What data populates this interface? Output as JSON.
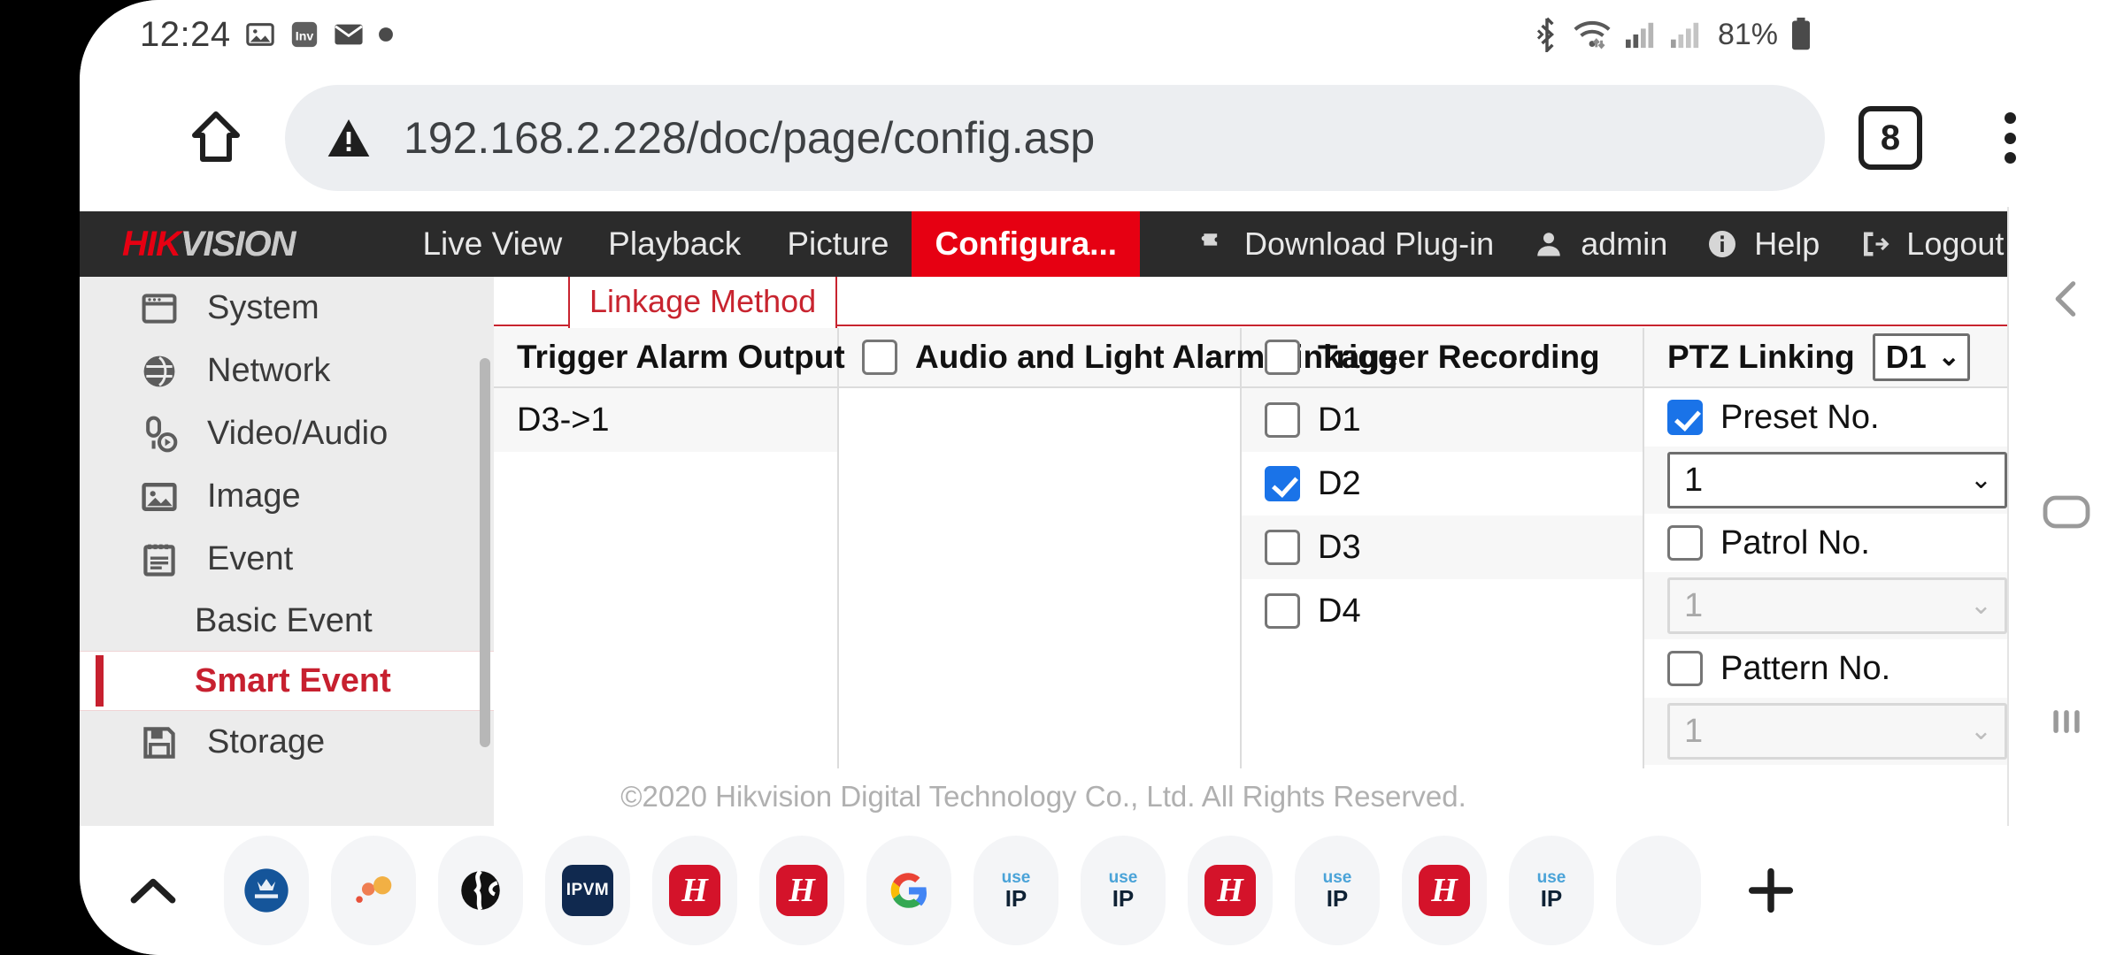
{
  "status_bar": {
    "clock": "12:24",
    "left_icons": [
      "image-icon",
      "inv-app-icon",
      "mail-icon",
      "dot-icon"
    ],
    "right_icons": [
      "bluetooth-icon",
      "wifi-icon",
      "signal-icon-1",
      "signal-icon-2"
    ],
    "battery_percent": "81%"
  },
  "browser": {
    "home_icon": "home-icon",
    "security_icon": "not-secure-warning-icon",
    "url": "192.168.2.228/doc/page/config.asp",
    "tab_count": "8",
    "menu_icon": "overflow-menu-icon"
  },
  "hikvision": {
    "logo_hik": "HIK",
    "logo_vision": "VISION",
    "nav": [
      {
        "label": "Live View",
        "active": false
      },
      {
        "label": "Playback",
        "active": false
      },
      {
        "label": "Picture",
        "active": false
      },
      {
        "label": "Configura...",
        "active": true
      }
    ],
    "nav_right": [
      {
        "label": "Download Plug-in",
        "icon": "plugin-icon"
      },
      {
        "label": "admin",
        "icon": "user-icon"
      },
      {
        "label": "Help",
        "icon": "info-icon"
      },
      {
        "label": "Logout",
        "icon": "logout-icon"
      }
    ],
    "accent_color": "#e60012"
  },
  "sidebar": {
    "items": [
      {
        "label": "System",
        "icon": "window-icon",
        "type": "parent"
      },
      {
        "label": "Network",
        "icon": "globe-icon",
        "type": "parent"
      },
      {
        "label": "Video/Audio",
        "icon": "mic-video-icon",
        "type": "parent"
      },
      {
        "label": "Image",
        "icon": "picture-icon",
        "type": "parent"
      },
      {
        "label": "Event",
        "icon": "calendar-list-icon",
        "type": "parent"
      }
    ],
    "sub_items": [
      {
        "label": "Basic Event",
        "selected": false
      },
      {
        "label": "Smart Event",
        "selected": true
      }
    ],
    "items_after": [
      {
        "label": "Storage",
        "icon": "floppy-disk-icon",
        "type": "parent"
      }
    ]
  },
  "content": {
    "tab": {
      "label": "Linkage Method",
      "active": true
    },
    "table": {
      "headers": [
        {
          "label": "Trigger Alarm Output",
          "checkbox": false,
          "has_checkbox": false
        },
        {
          "label": "Audio and Light Alarm Linkage",
          "has_checkbox": true,
          "checked": false
        },
        {
          "label": "Trigger Recording",
          "has_checkbox": true,
          "checked": false
        },
        {
          "label": "PTZ Linking",
          "has_checkbox": false,
          "select_value": "D1"
        }
      ],
      "trigger_alarm_output": [
        {
          "label": "D3->1",
          "checked": false
        }
      ],
      "audio_light": [],
      "trigger_recording": [
        {
          "label": "D1",
          "checked": false
        },
        {
          "label": "D2",
          "checked": true
        },
        {
          "label": "D3",
          "checked": false
        },
        {
          "label": "D4",
          "checked": false
        }
      ],
      "ptz_linking": {
        "channel_select": "D1",
        "preset": {
          "label": "Preset No.",
          "checked": true,
          "value": "1",
          "enabled": true
        },
        "patrol": {
          "label": "Patrol No.",
          "checked": false,
          "value": "1",
          "enabled": false
        },
        "pattern": {
          "label": "Pattern No.",
          "checked": false,
          "value": "1",
          "enabled": false
        }
      }
    },
    "copyright": "©2020 Hikvision Digital Technology Co., Ltd. All Rights Reserved."
  },
  "system_nav": {
    "back_icon": "back-chevron-icon",
    "home_icon": "home-pill-icon",
    "recents_icon": "recents-bars-icon"
  },
  "dock": {
    "expand_icon": "chevron-up-icon",
    "items": [
      {
        "name": "hotel-crest-bookmark",
        "type": "crest"
      },
      {
        "name": "dots-bookmark",
        "type": "dots"
      },
      {
        "name": "globe-bookmark",
        "type": "globe"
      },
      {
        "name": "ipvm-bookmark",
        "type": "ipvm",
        "label": "IPVM"
      },
      {
        "name": "hikvision-bookmark-1",
        "type": "hik",
        "label": "H"
      },
      {
        "name": "hikvision-bookmark-2",
        "type": "hik",
        "label": "H"
      },
      {
        "name": "google-bookmark",
        "type": "google",
        "label": "G"
      },
      {
        "name": "useip-bookmark-1",
        "type": "useip",
        "label_top": "use",
        "label_bottom": "IP"
      },
      {
        "name": "useip-bookmark-2",
        "type": "useip",
        "label_top": "use",
        "label_bottom": "IP"
      },
      {
        "name": "hikvision-bookmark-3",
        "type": "hik",
        "label": "H"
      },
      {
        "name": "useip-bookmark-3",
        "type": "useip",
        "label_top": "use",
        "label_bottom": "IP"
      },
      {
        "name": "hikvision-bookmark-4",
        "type": "hik",
        "label": "H"
      },
      {
        "name": "useip-bookmark-4",
        "type": "useip",
        "label_top": "use",
        "label_bottom": "IP"
      }
    ],
    "add_icon": "plus-icon"
  }
}
